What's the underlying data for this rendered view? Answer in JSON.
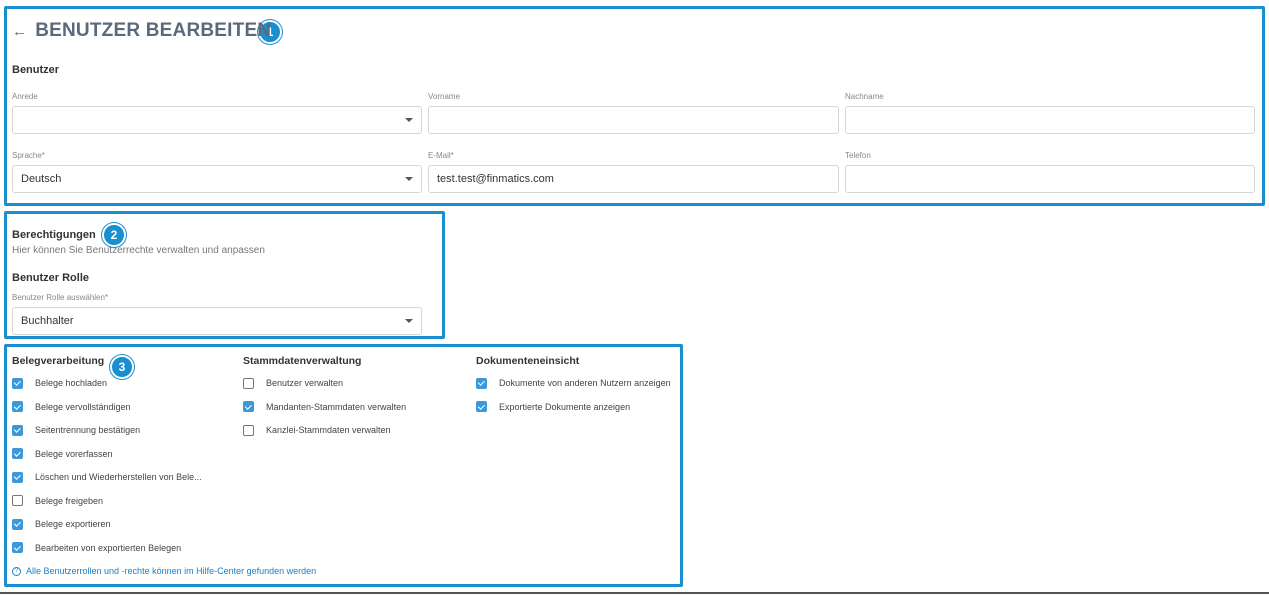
{
  "header": {
    "back_icon": "arrow-left-icon",
    "title": "BENUTZER BEARBEITEN"
  },
  "badges": [
    "1",
    "2",
    "3"
  ],
  "user": {
    "section_title": "Benutzer",
    "anrede": {
      "label": "Anrede",
      "value": ""
    },
    "vorname": {
      "label": "Vorname",
      "value": ""
    },
    "nachname": {
      "label": "Nachname",
      "value": ""
    },
    "sprache": {
      "label": "Sprache*",
      "value": "Deutsch"
    },
    "email": {
      "label": "E-Mail*",
      "value": "test.test@finmatics.com"
    },
    "telefon": {
      "label": "Telefon",
      "value": ""
    }
  },
  "permissions": {
    "title": "Berechtigungen",
    "subtitle": "Hier können Sie Benutzerrechte verwalten und anpassen",
    "role_heading": "Benutzer Rolle",
    "role_label": "Benutzer Rolle auswählen*",
    "role_value": "Buchhalter"
  },
  "columns": [
    {
      "title": "Belegverarbeitung",
      "items": [
        {
          "label": "Belege hochladen",
          "checked": true
        },
        {
          "label": "Belege vervollständigen",
          "checked": true
        },
        {
          "label": "Seitentrennung bestätigen",
          "checked": true
        },
        {
          "label": "Belege vorerfassen",
          "checked": true
        },
        {
          "label": "Löschen und Wiederherstellen von Bele...",
          "checked": true
        },
        {
          "label": "Belege freigeben",
          "checked": false
        },
        {
          "label": "Belege exportieren",
          "checked": true
        },
        {
          "label": "Bearbeiten von exportierten Belegen",
          "checked": true
        }
      ]
    },
    {
      "title": "Stammdatenverwaltung",
      "items": [
        {
          "label": "Benutzer verwalten",
          "checked": false
        },
        {
          "label": "Mandanten-Stammdaten verwalten",
          "checked": true
        },
        {
          "label": "Kanzlei-Stammdaten verwalten",
          "checked": false
        }
      ]
    },
    {
      "title": "Dokumenteneinsicht",
      "items": [
        {
          "label": "Dokumente von anderen Nutzern anzeigen",
          "checked": true
        },
        {
          "label": "Exportierte Dokumente anzeigen",
          "checked": true
        }
      ]
    }
  ],
  "help": {
    "icon": "help-circle-icon",
    "text": "Alle Benutzerrollen und -rechte können im Hilfe-Center gefunden werden"
  },
  "colors": {
    "accent": "#1a8fcf",
    "checkbox": "#3a9ad9",
    "link": "#1a7fc4"
  }
}
